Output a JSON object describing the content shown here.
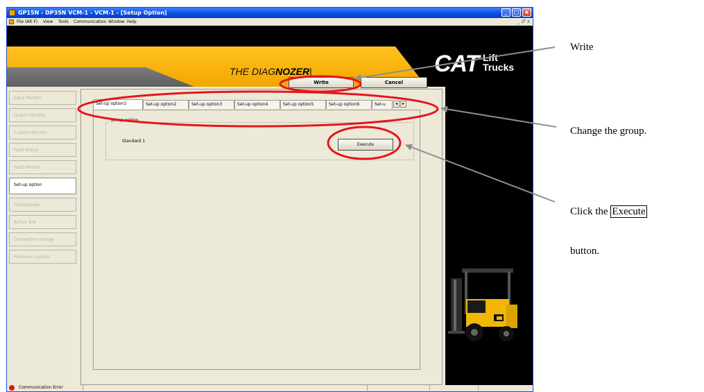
{
  "window": {
    "title": "GP15N - DP35N VCM-1 - VCM-1 - [Setup Option]",
    "controls": {
      "minimize": "_",
      "maximize": "□",
      "close": "x"
    }
  },
  "menu": {
    "items": [
      "File (Alt F)",
      "View",
      "Tools",
      "Communication",
      "Window",
      "Help"
    ],
    "mdi_controls": "_ ♂ x"
  },
  "banner": {
    "product_prefix": "THE DIAG",
    "product_bold": "NOZER",
    "product_suffix": "|",
    "logo_cat": "CAT",
    "logo_line1": "Lift",
    "logo_line2": "Trucks"
  },
  "sidebar": {
    "items": [
      {
        "label": "Input Monitor",
        "active": false
      },
      {
        "label": "Output Monitor",
        "active": false
      },
      {
        "label": "Custom Monitor",
        "active": false
      },
      {
        "label": "Fault Status",
        "active": false
      },
      {
        "label": "Fault History",
        "active": false
      },
      {
        "label": "Set-up option",
        "active": true
      },
      {
        "label": "Oscilloscope",
        "active": false
      },
      {
        "label": "Active Test",
        "active": false
      },
      {
        "label": "Connection change",
        "active": false
      },
      {
        "label": "Firmware Update",
        "active": false
      }
    ]
  },
  "toolbar": {
    "write_label": "Write",
    "cancel_label": "Cancel"
  },
  "tabs": {
    "items": [
      "Set-up option1",
      "Set-up option2",
      "Set-up option3",
      "Set-up option4",
      "Set-up option5",
      "Set-up option6",
      "Set-u"
    ],
    "active_index": 0,
    "scroll_left": "◂",
    "scroll_right": "▸"
  },
  "group": {
    "title": "Set-up option",
    "row_label": "Standard 1",
    "execute_label": "Execute"
  },
  "status": {
    "message": "Communication Error",
    "color": "#d81a10"
  },
  "annotations": {
    "write": "Write",
    "change_group": "Change the group.",
    "click_prefix": "Click the ",
    "click_boxed": "Execute",
    "click_line2": "button."
  },
  "colors": {
    "accent_orange": "#f3a700",
    "annotation_circle": "#e8141b",
    "arrow": "#8f8f8f"
  }
}
